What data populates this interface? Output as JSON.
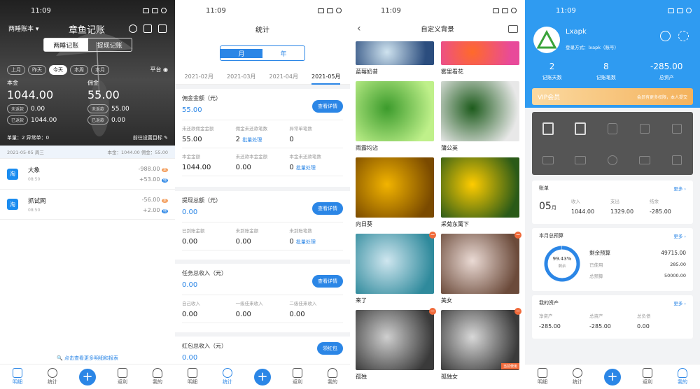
{
  "s1": {
    "time": "11:09",
    "book": "两睡账本",
    "app_title": "章鱼记账",
    "seg": [
      "两睡记账",
      "提现记账"
    ],
    "periods": [
      "上月",
      "昨天",
      "今天",
      "本周",
      "本月"
    ],
    "platform": "平台",
    "principal_label": "本金",
    "principal": "1044.00",
    "commission_label": "佣金",
    "commission": "55.00",
    "left_stats": [
      {
        "tag": "未返款",
        "val": "0.00"
      },
      {
        "tag": "已返款",
        "val": "1044.00"
      }
    ],
    "right_stats": [
      {
        "tag": "未返款",
        "val": "55.00"
      },
      {
        "tag": "已返款",
        "val": "0.00"
      }
    ],
    "orders": "单量：2 异常单：0",
    "goal": "前往设置目标",
    "date_line": "2021-05-05 周三",
    "date_sum": "本金：1044.00  佣金：55.00",
    "records": [
      {
        "logo": "淘",
        "name": "大象",
        "time": "08:50",
        "amt1": "-988.00",
        "amt2": "+53.00",
        "b1": "本",
        "b2": "佣"
      },
      {
        "logo": "淘",
        "name": "抓试网",
        "time": "08:50",
        "amt1": "-56.00",
        "amt2": "+2.00",
        "b1": "本",
        "b2": "佣"
      }
    ],
    "more": "点击查看更多明细和报表",
    "tabs": [
      "明细",
      "统计",
      "",
      "返利",
      "我的"
    ]
  },
  "s2": {
    "time": "11:09",
    "title": "统计",
    "seg": [
      "月",
      "年"
    ],
    "months": [
      "2021-02月",
      "2021-03月",
      "2021-04月",
      "2021-05月"
    ],
    "sections": [
      {
        "title": "佣金金额（元）",
        "value": "55.00",
        "btn": "查看详情",
        "cells": [
          {
            "l": "未还款佣金金额",
            "v": "55.00"
          },
          {
            "l": "佣金未还款笔数",
            "v": "2",
            "link": "批量处理"
          },
          {
            "l": "异常单笔数",
            "v": "0"
          },
          {
            "l": "本金金额",
            "v": "1044.00"
          },
          {
            "l": "未还款本金金额",
            "v": "0.00"
          },
          {
            "l": "本金未还款笔数",
            "v": "0",
            "link": "批量处理"
          }
        ]
      },
      {
        "title": "提现总额（元）",
        "value": "0.00",
        "btn": "查看详情",
        "cells": [
          {
            "l": "已到账金额",
            "v": "0.00"
          },
          {
            "l": "未到账金额",
            "v": "0.00"
          },
          {
            "l": "未到账笔数",
            "v": "0",
            "link": "批量处理"
          }
        ]
      },
      {
        "title": "任务总收入（元）",
        "value": "0.00",
        "btn": "查看详情",
        "cells": [
          {
            "l": "自己收入",
            "v": "0.00"
          },
          {
            "l": "一级佳来收入",
            "v": "0.00"
          },
          {
            "l": "二级佳来收入",
            "v": "0.00"
          }
        ]
      },
      {
        "title": "红包总收入（元）",
        "value": "0.00",
        "btn": "领红包",
        "cells": []
      }
    ],
    "tabs": [
      "明细",
      "统计",
      "",
      "返利",
      "我的"
    ]
  },
  "s3": {
    "time": "11:09",
    "title": "自定义背景",
    "photos": [
      {
        "cap": "蓝莓奶昔",
        "c1": "#cfe3ef",
        "c2": "#2b4d7e"
      },
      {
        "cap": "雾里看花",
        "c1": "#ff6a2a",
        "c2": "#e84a9a"
      },
      {
        "cap": "雨露均沾",
        "c1": "#3c9b2c",
        "c2": "#bff08a"
      },
      {
        "cap": "蒲公英",
        "c1": "#1d5b1c",
        "c2": "#e8e8e8"
      },
      {
        "cap": "向日葵",
        "c1": "#f2b400",
        "c2": "#7a4a00"
      },
      {
        "cap": "采菊东篱下",
        "c1": "#ffcc00",
        "c2": "#2a5a18"
      },
      {
        "cap": "来了",
        "c1": "#cfe6ef",
        "c2": "#2f8a9c"
      },
      {
        "cap": "美女",
        "c1": "#eadad4",
        "c2": "#6b4a3a"
      },
      {
        "cap": "孤独",
        "c1": "#cfcfcf",
        "c2": "#3a3a3a"
      },
      {
        "cap": "孤独女",
        "c1": "#d8d8d8",
        "c2": "#3a3a3a",
        "badge": "当前使用"
      }
    ]
  },
  "s4": {
    "time": "11:09",
    "name": "Lxapk",
    "login": "登录方式：lxapk（账号）",
    "stats": [
      {
        "v": "2",
        "l": "记账天数"
      },
      {
        "v": "8",
        "l": "记账笔数"
      },
      {
        "v": "-285.00",
        "l": "总资产"
      }
    ],
    "vip": "VIP会员",
    "vip_note": "会员有更多权限，本人提交",
    "grid_icons": [
      "doc-icon",
      "receipt-icon",
      "bag-icon",
      "box-icon",
      "lock-icon",
      "mail-icon",
      "inbox-icon",
      "gift-icon",
      "card-icon",
      "book-icon"
    ],
    "bill": {
      "title": "账单",
      "more": "更多",
      "day": "05",
      "unit": "月",
      "cols": [
        {
          "l": "收入",
          "v": "1044.00"
        },
        {
          "l": "支出",
          "v": "1329.00"
        },
        {
          "l": "结余",
          "v": "-285.00"
        }
      ]
    },
    "budget": {
      "title": "本月总预算",
      "more": "更多",
      "pct": "99.43%",
      "sub": "剩余",
      "rows": [
        {
          "l": "剩余预算",
          "v": "49715.00"
        },
        {
          "l": "已使用",
          "v": "285.00"
        },
        {
          "l": "总预算",
          "v": "50000.00"
        }
      ],
      "ratio": 0.9943
    },
    "assets": {
      "title": "我的资产",
      "more": "更多",
      "cols": [
        {
          "l": "净资产",
          "v": "-285.00"
        },
        {
          "l": "总资产",
          "v": "-285.00"
        },
        {
          "l": "总负债",
          "v": "0.00"
        }
      ]
    },
    "tabs": [
      "明细",
      "统计",
      "",
      "返利",
      "我的"
    ]
  }
}
